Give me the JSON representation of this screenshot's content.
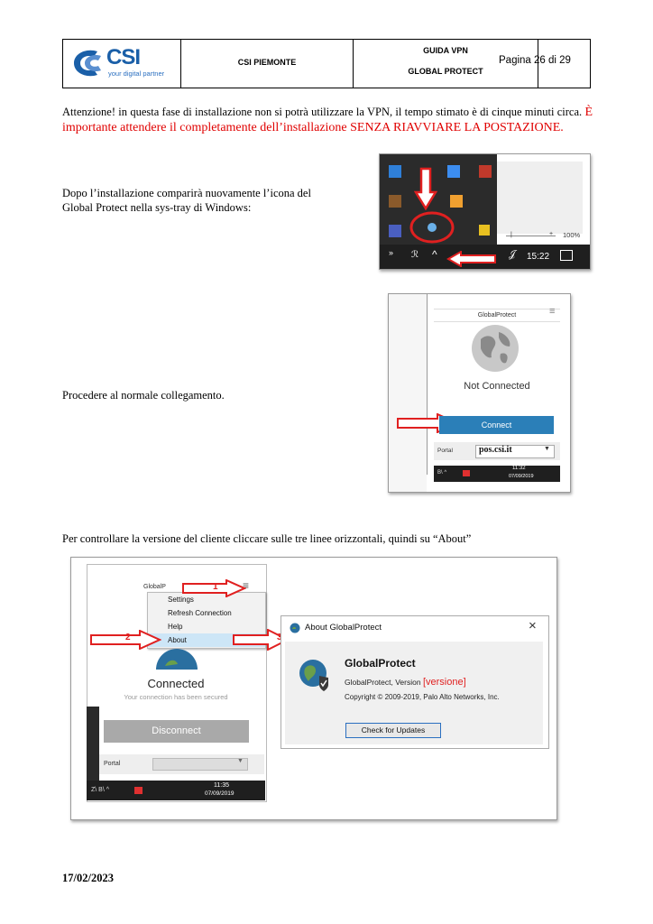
{
  "header": {
    "logo_text": "CSI",
    "logo_tagline": "your digital partner",
    "org": "CSI PIEMONTE",
    "guide_line1": "GUIDA VPN",
    "guide_line2": "GLOBAL PROTECT",
    "page": "Pagina 26 di 29"
  },
  "body": {
    "warning_black": "Attenzione! in questa fase di installazione non si potrà utilizzare la VPN, il tempo stimato è di cinque minuti circa.",
    "warning_red": "È importante attendere il completamente dell’installazione SENZA RIAVVIARE LA POSTAZIONE.",
    "after_install": "Dopo l’installazione comparirà nuovamente l’icona del Global Protect nella sys-tray di Windows:",
    "proceed": "Procedere al normale collegamento.",
    "check_version": "Per controllare la versione del cliente cliccare sulle tre linee orizzontali, quindi su “About”"
  },
  "tray_screenshot": {
    "zoom": "100%",
    "time": "15:22"
  },
  "gp_window": {
    "title": "GlobalProtect",
    "status": "Not Connected",
    "connect_label": "Connect",
    "portal_label": "Portal",
    "portal_value": "pos.csi.it",
    "time": "11:32",
    "date": "07/09/2019"
  },
  "about_screenshot": {
    "gp_title": "GlobalP",
    "menu": [
      "Settings",
      "Refresh Connection",
      "Help",
      "About"
    ],
    "status": "Connected",
    "status_sub": "Your connection has been secured",
    "disconnect_label": "Disconnect",
    "portal_label": "Portal",
    "time": "11:35",
    "date": "07/09/2019",
    "steps": [
      "1",
      "2",
      "3"
    ],
    "about_title": "About GlobalProtect",
    "product": "GlobalProtect",
    "version_prefix": "GlobalProtect, Version",
    "version_value": "[versione]",
    "copyright": "Copyright © 2009-2019, Palo Alto Networks, Inc.",
    "check_updates": "Check for Updates",
    "close": "×"
  },
  "footer": {
    "date": "17/02/2023"
  },
  "colors": {
    "accent_red": "#e00000",
    "connect_blue": "#2b7fb8",
    "logo_blue": "#1a5fa8"
  }
}
